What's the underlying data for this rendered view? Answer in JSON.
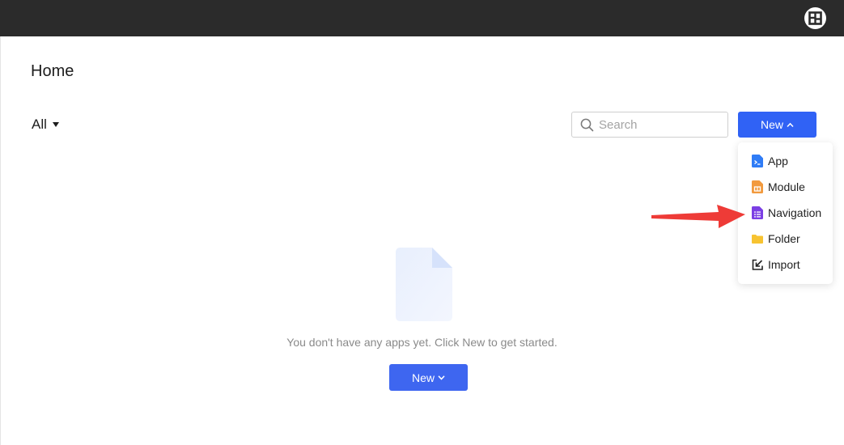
{
  "header": {
    "logo_icon": "workspace-logo-icon"
  },
  "page": {
    "title": "Home"
  },
  "filter": {
    "label": "All"
  },
  "search": {
    "placeholder": "Search",
    "value": ""
  },
  "toolbar": {
    "new_label": "New"
  },
  "new_menu": {
    "items": [
      {
        "label": "App",
        "icon": "app-icon",
        "color": "#2f7cf6"
      },
      {
        "label": "Module",
        "icon": "module-icon",
        "color": "#f29a3e"
      },
      {
        "label": "Navigation",
        "icon": "navigation-icon",
        "color": "#7b3fe4"
      },
      {
        "label": "Folder",
        "icon": "folder-icon",
        "color": "#f7c331"
      },
      {
        "label": "Import",
        "icon": "import-icon",
        "color": "#222222"
      }
    ]
  },
  "empty_state": {
    "message": "You don't have any apps yet. Click New to get started.",
    "new_label": "New"
  },
  "colors": {
    "accent": "#3062f5",
    "topbar": "#2b2b2b",
    "annotation_arrow": "#ee3b37"
  }
}
